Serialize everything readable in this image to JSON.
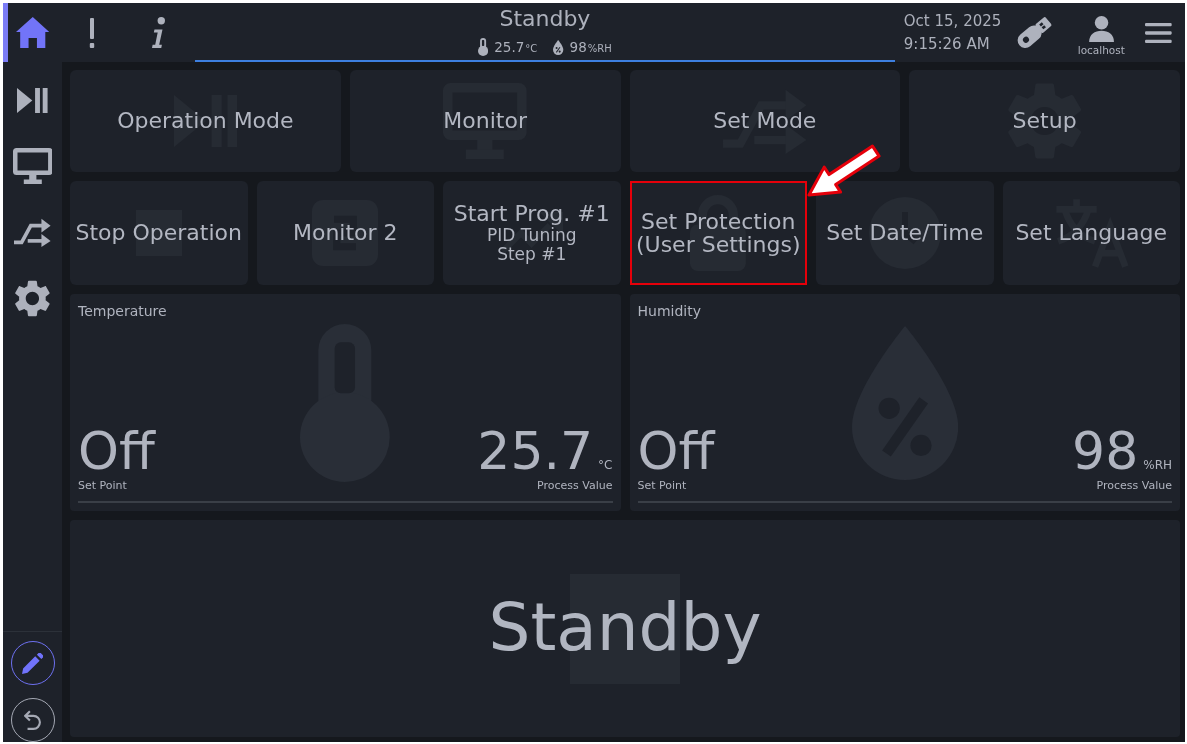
{
  "sidebar": {
    "items": [
      {
        "kind": "home",
        "selected": true
      },
      {
        "kind": "operation",
        "selected": false
      },
      {
        "kind": "monitor",
        "selected": false
      },
      {
        "kind": "set_mode",
        "selected": false
      },
      {
        "kind": "setup",
        "selected": false
      }
    ],
    "tools": [
      {
        "kind": "edit",
        "active": true
      },
      {
        "kind": "undo",
        "active": false
      }
    ]
  },
  "header": {
    "buttons": [
      {
        "kind": "alert"
      },
      {
        "kind": "info"
      }
    ],
    "status": "Standby",
    "readings": [
      {
        "kind": "temperature",
        "value": "25.7",
        "unit": "°C"
      },
      {
        "kind": "humidity",
        "value": "98",
        "unit": "%RH"
      }
    ],
    "date": "Oct 15, 2025",
    "time": "9:15:26 AM",
    "user": "localhost"
  },
  "tiles": [
    [
      {
        "kind": "operation",
        "label": "Operation Mode",
        "highlighted": false
      },
      {
        "kind": "monitor",
        "label": "Monitor",
        "highlighted": false
      },
      {
        "kind": "set_mode",
        "label": "Set Mode",
        "highlighted": false
      },
      {
        "kind": "setup",
        "label": "Setup",
        "highlighted": false
      }
    ],
    [
      {
        "kind": "stop",
        "label": "Stop Operation",
        "highlighted": false
      },
      {
        "kind": "monitor_2",
        "label": "Monitor 2",
        "highlighted": false
      },
      {
        "kind": "program",
        "label": "Start Prog. #1",
        "details": [
          "PID Tuning",
          "Step #1"
        ],
        "highlighted": false
      },
      {
        "kind": "protection",
        "label": "Set Protection (User Settings)",
        "highlighted": true
      },
      {
        "kind": "date_time",
        "label": "Set Date/Time",
        "highlighted": false
      },
      {
        "kind": "language",
        "label": "Set Language",
        "highlighted": false
      }
    ]
  ],
  "panels": [
    {
      "kind": "temperature",
      "title": "Temperature",
      "set_point": "Off",
      "set_point_label": "Set Point",
      "process_value": "25.7",
      "unit": "°C",
      "process_value_label": "Process Value"
    },
    {
      "kind": "humidity",
      "title": "Humidity",
      "set_point": "Off",
      "set_point_label": "Set Point",
      "process_value": "98",
      "unit": "%RH",
      "process_value_label": "Process Value"
    }
  ],
  "status_panel": {
    "text": "Standby"
  }
}
